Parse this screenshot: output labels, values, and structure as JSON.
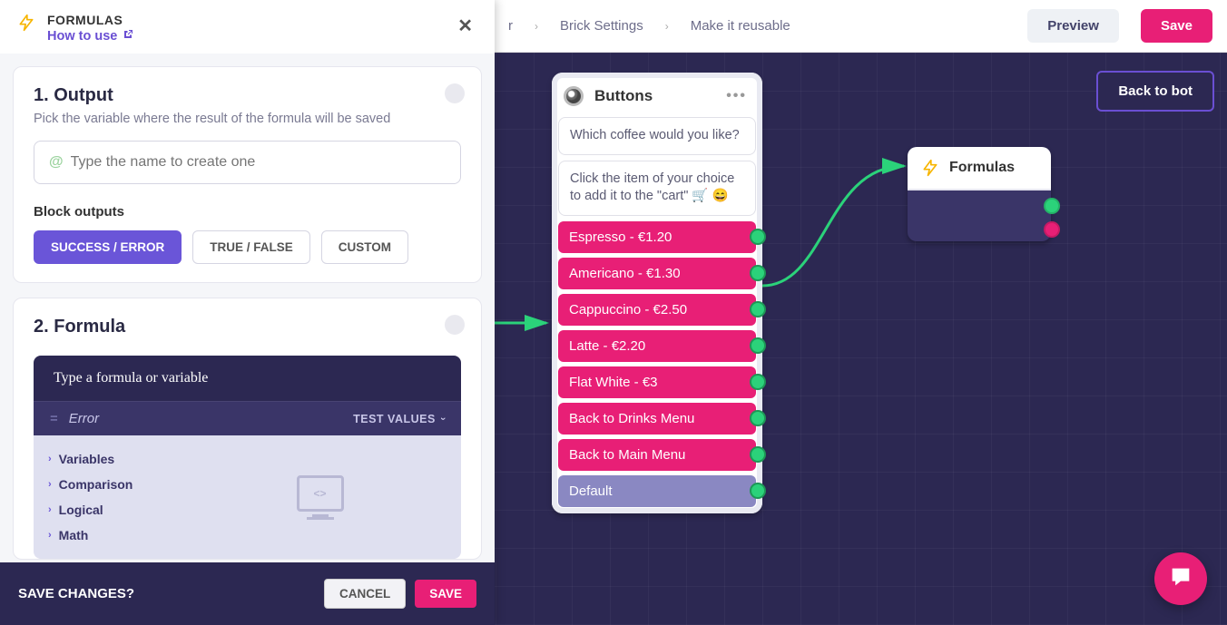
{
  "topbar": {
    "crumb1": "r",
    "crumb2": "Brick Settings",
    "crumb3": "Make it reusable",
    "preview": "Preview",
    "save": "Save"
  },
  "canvas": {
    "back": "Back to bot"
  },
  "nodeButtons": {
    "title": "Buttons",
    "msg1": "Which coffee would you like?",
    "msg2": "Click the item of your choice to add it to the \"cart\" 🛒 😄",
    "options": [
      "Espresso - €1.20",
      "Americano - €1.30",
      "Cappuccino - €2.50",
      "Latte - €2.20",
      "Flat White - €3",
      "Back to Drinks Menu",
      "Back to Main Menu"
    ],
    "default": "Default"
  },
  "nodeFormulas": {
    "title": "Formulas"
  },
  "panel": {
    "title": "FORMULAS",
    "howto": "How to use",
    "section1": {
      "heading": "1. Output",
      "sub": "Pick the variable where the result of the formula will be saved",
      "placeholder": "Type the name to create one",
      "blockOutputs": "Block outputs",
      "pills": [
        "SUCCESS / ERROR",
        "TRUE / FALSE",
        "CUSTOM"
      ]
    },
    "section2": {
      "heading": "2. Formula",
      "hint": "Type a formula or variable",
      "error": "Error",
      "testValues": "TEST VALUES",
      "cats": [
        "Variables",
        "Comparison",
        "Logical",
        "Math"
      ]
    },
    "footer": {
      "question": "SAVE CHANGES?",
      "cancel": "CANCEL",
      "save": "SAVE"
    }
  }
}
